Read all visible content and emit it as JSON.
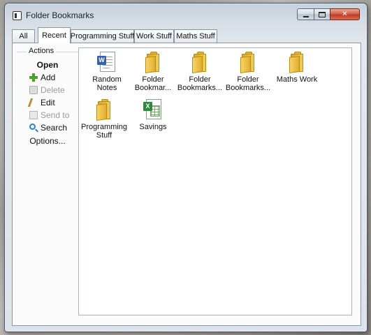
{
  "window": {
    "title": "Folder Bookmarks"
  },
  "tabs": [
    {
      "label": "All",
      "active": false
    },
    {
      "label": "Recent",
      "active": true
    },
    {
      "label": "Programming Stuff",
      "active": false
    },
    {
      "label": "Work Stuff",
      "active": false
    },
    {
      "label": "Maths Stuff",
      "active": false
    }
  ],
  "sidebar": {
    "title": "Actions",
    "items": [
      {
        "label": "Open",
        "icon": "none",
        "enabled": true
      },
      {
        "label": "Add",
        "icon": "plus-icon",
        "enabled": true
      },
      {
        "label": "Delete",
        "icon": "trash-icon",
        "enabled": false
      },
      {
        "label": "Edit",
        "icon": "pencil-icon",
        "enabled": true
      },
      {
        "label": "Send to",
        "icon": "send-icon",
        "enabled": false
      },
      {
        "label": "Search",
        "icon": "search-icon",
        "enabled": true
      },
      {
        "label": "Options...",
        "icon": "none",
        "enabled": true
      }
    ]
  },
  "bookmarks": [
    {
      "label": "Random Notes",
      "type": "word-document"
    },
    {
      "label": "Folder Bookmar...",
      "type": "folder"
    },
    {
      "label": "Folder Bookmarks...",
      "type": "folder"
    },
    {
      "label": "Folder Bookmarks...",
      "type": "folder"
    },
    {
      "label": "Maths Work",
      "type": "folder"
    },
    {
      "label": "Programming Stuff",
      "type": "folder"
    },
    {
      "label": "Savings",
      "type": "excel-spreadsheet"
    }
  ],
  "colors": {
    "folder": "#f3cf55",
    "close_button": "#c23b22",
    "add_icon": "#4aa12d",
    "search_icon": "#2a7fcf"
  }
}
